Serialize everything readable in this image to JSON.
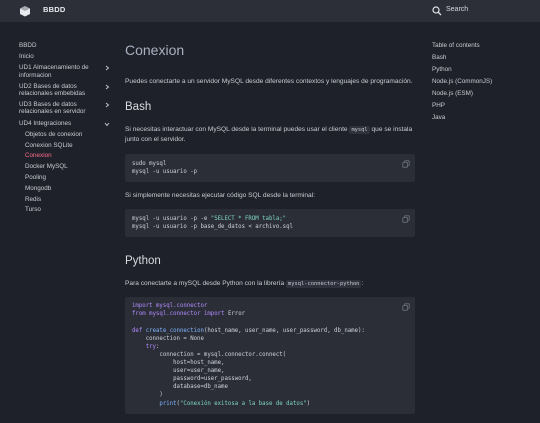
{
  "header": {
    "site_title": "BBDD",
    "search_label": "Search"
  },
  "sidebar": {
    "items": [
      {
        "label": "BBDD"
      },
      {
        "label": "Inicio"
      },
      {
        "label": "UD1 Almacenamiento de informacion"
      },
      {
        "label": "UD2 Bases de datos relacionales embebidas"
      },
      {
        "label": "UD3 Bases de datos relacionales en servidor"
      },
      {
        "label": "UD4 Integraciones"
      }
    ],
    "subitems": [
      {
        "label": "Objetos de conexion"
      },
      {
        "label": "Conexion SQLite"
      },
      {
        "label": "Conexion"
      },
      {
        "label": "Docker MySQL"
      },
      {
        "label": "Pooling"
      },
      {
        "label": "Mongodb"
      },
      {
        "label": "Redis"
      },
      {
        "label": "Turso"
      }
    ]
  },
  "content": {
    "title": "Conexion",
    "intro": "Puedes conectarte a un servidor MySQL desde diferentes contextos y lenguajes de programación.",
    "bash": {
      "heading": "Bash",
      "p1_before": "Si necesitas interactuar con MySQL desde la terminal puedes usar el cliente ",
      "p1_code": "mysql",
      "p1_after": " que se instala junto con el servidor.",
      "code1": "sudo mysql\nmysql -u usuario -p",
      "p2": "Si simplemente necesitas ejecutar código SQL desde la terminal:",
      "code2_l1a": "mysql -u usuario -p -e ",
      "code2_l1b": "\"SELECT * FROM tabla;\"",
      "code2_l2": "mysql -u usuario -p base_de_datos < archivo.sql"
    },
    "python": {
      "heading": "Python",
      "p1_before": "Para conectarte a mySQL desde Python con la librería ",
      "p1_code": "mysql-connector-python",
      "p1_after": ":",
      "import1_kw": "import",
      "import1_mod": "mysql.connector",
      "from_kw": "from",
      "from_mod": "mysql.connector",
      "from_import_kw": "import",
      "from_name": "Error",
      "def_kw": "def",
      "def_name": "create_connection",
      "def_args": "(host_name, user_name, user_password, db_name):",
      "line_conn": "    connection = None",
      "try_kw": "try",
      "line_connect": "        connection = mysql.connector.connect(",
      "line_host": "            host=host_name,",
      "line_user": "            user=user_name,",
      "line_pass": "            password=user_password,",
      "line_db": "            database=db_name",
      "line_close": "        )",
      "print_fn": "print",
      "print_str": "\"Conexión exitosa a la base de datos\""
    }
  },
  "toc": {
    "title": "Table of contents",
    "items": [
      "Bash",
      "Python",
      "Node.js (CommonJS)",
      "Node.js (ESM)",
      "PHP",
      "Java"
    ]
  },
  "colors": {
    "accent": "#ff6e8a",
    "background": "#1e2129",
    "header": "#2d2f38",
    "code_bg": "#2b2e37"
  }
}
